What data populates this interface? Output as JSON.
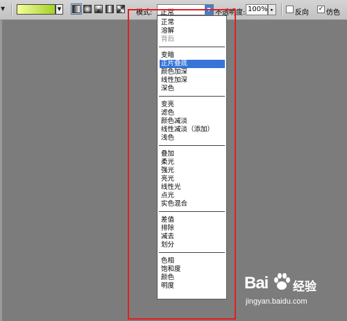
{
  "toolbar": {
    "mode_label": "模式:",
    "mode_value": "正常",
    "opacity_label": "不透明度:",
    "opacity_value": "100%",
    "reverse_label": "反向",
    "reverse_checked": false,
    "dither_label": "仿色",
    "dither_checked": true,
    "gradient_colors": [
      "#f5ff9a",
      "#a5d02a"
    ]
  },
  "mode_menu": {
    "groups": [
      [
        "正常",
        "溶解",
        "背后"
      ],
      [
        "变暗",
        "正片叠底",
        "颜色加深",
        "线性加深",
        "深色"
      ],
      [
        "变亮",
        "滤色",
        "颜色减淡",
        "线性减淡（添加）",
        "浅色"
      ],
      [
        "叠加",
        "柔光",
        "强光",
        "亮光",
        "线性光",
        "点光",
        "实色混合"
      ],
      [
        "差值",
        "排除",
        "减去",
        "划分"
      ],
      [
        "色相",
        "饱和度",
        "颜色",
        "明度"
      ]
    ],
    "highlighted": "正片叠底",
    "disabled": [
      "背后"
    ]
  },
  "watermark": {
    "brand_left": "Bai",
    "brand_right": "du",
    "brand_cn": "经验",
    "url": "jingyan.baidu.com"
  },
  "colors": {
    "highlight_border": "#e21e1e",
    "menu_highlight": "#3875d7",
    "canvas": "#7c7c7c"
  }
}
